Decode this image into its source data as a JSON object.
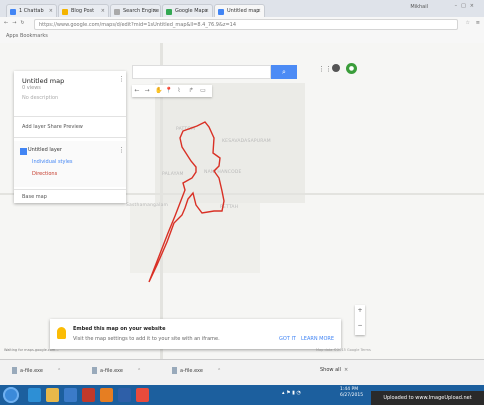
{
  "browser": {
    "tabs": [
      {
        "label": "1 Chattab"
      },
      {
        "label": "Blog Post"
      },
      {
        "label": "Search Engine"
      },
      {
        "label": "Google Maps"
      },
      {
        "label": "Untitled map"
      }
    ],
    "profile": "Mikhail",
    "url": "https://www.google.com/maps/d/edit?mid=1sUntitled_map&ll=8.4_76.9&z=14",
    "bookmarks": "Apps  Bookmarks"
  },
  "panel": {
    "title": "Untitled map",
    "views": "0 views",
    "description": "No description",
    "actions": "Add layer   Share   Preview",
    "layer_name": "Untitled layer",
    "layer_style": "Individual styles",
    "layer_item": "Directions",
    "basemap": "Base map"
  },
  "search": {
    "placeholder": ""
  },
  "map": {
    "places": [
      {
        "label": "PATTOM"
      },
      {
        "label": "KESAVADASAPURAM"
      },
      {
        "label": "PALAYAM"
      },
      {
        "label": "NANTHANCODE"
      },
      {
        "label": "Sasthamangalam"
      },
      {
        "label": "PETTAH"
      }
    ],
    "route_color": "#d93025"
  },
  "notification": {
    "title": "Embed this map on your website",
    "body": "Visit the map settings to add it to your site with an iframe.",
    "action_primary": "GOT IT",
    "action_secondary": "LEARN MORE"
  },
  "credit": "Map data ©2015 Google  Terms",
  "status": "Waiting for maps.google.com...",
  "downloads": [
    {
      "name": "a-file.exe"
    },
    {
      "name": "a-file.exe"
    },
    {
      "name": "a-file.exe"
    }
  ],
  "downloads_showall": "Show all",
  "clock": {
    "time": "1:44 PM",
    "date": "6/27/2015"
  },
  "watermark": "Uploaded to www.ImageUpload.net",
  "icons": [
    "back-icon",
    "forward-icon",
    "reload-icon",
    "star-icon",
    "menu-icon",
    "search-icon",
    "apps-grid-icon",
    "notifications-icon",
    "hand-icon",
    "marker-icon",
    "line-icon",
    "directions-icon",
    "ruler-icon",
    "undo-icon"
  ]
}
